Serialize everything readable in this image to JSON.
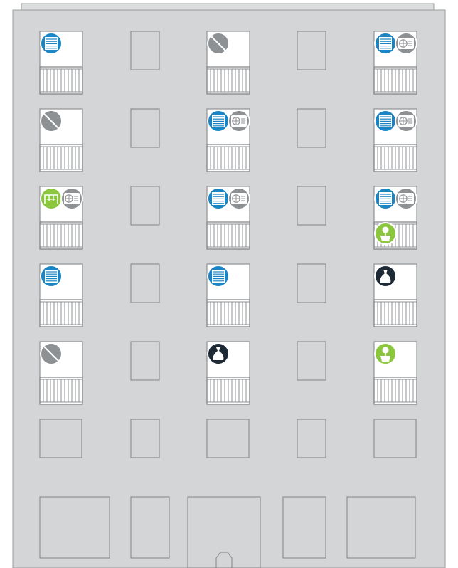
{
  "colors": {
    "facade": "#d4d5d7",
    "facade_stroke": "#9a9c9e",
    "roof": "#dcdddf",
    "window_white": "#ffffff",
    "window_outline": "#8f9193",
    "railing": "#8f9193",
    "blue": "#1b84c2",
    "gray": "#8e9194",
    "green": "#8cc63f",
    "black": "#1d2a35"
  },
  "legend_icons": {
    "blinds": "blinds-icon",
    "no_entry": "no-entry-icon",
    "ac": "ac-unit-icon",
    "clothes": "clothes-rack-icon",
    "plant": "plant-pot-icon",
    "bag": "bag-icon"
  },
  "floors": [
    {
      "floor": 1,
      "balconies": [
        {
          "column": 1,
          "icons": [
            "blinds"
          ]
        },
        {
          "column": 3,
          "icons": [
            "no_entry"
          ]
        },
        {
          "column": 5,
          "icons": [
            "blinds",
            "ac"
          ]
        }
      ]
    },
    {
      "floor": 2,
      "balconies": [
        {
          "column": 1,
          "icons": [
            "no_entry"
          ]
        },
        {
          "column": 3,
          "icons": [
            "blinds",
            "ac"
          ]
        },
        {
          "column": 5,
          "icons": [
            "blinds",
            "ac"
          ]
        }
      ]
    },
    {
      "floor": 3,
      "balconies": [
        {
          "column": 1,
          "icons": [
            "clothes",
            "ac"
          ]
        },
        {
          "column": 3,
          "icons": [
            "blinds",
            "ac"
          ]
        },
        {
          "column": 5,
          "icons": [
            "blinds",
            "ac",
            "plant"
          ]
        }
      ]
    },
    {
      "floor": 4,
      "balconies": [
        {
          "column": 1,
          "icons": [
            "blinds"
          ]
        },
        {
          "column": 3,
          "icons": [
            "blinds"
          ]
        },
        {
          "column": 5,
          "icons": [
            "bag"
          ]
        }
      ]
    },
    {
      "floor": 5,
      "balconies": [
        {
          "column": 1,
          "icons": [
            "no_entry"
          ]
        },
        {
          "column": 3,
          "icons": [
            "bag"
          ]
        },
        {
          "column": 5,
          "icons": [
            "plant"
          ]
        }
      ]
    }
  ]
}
